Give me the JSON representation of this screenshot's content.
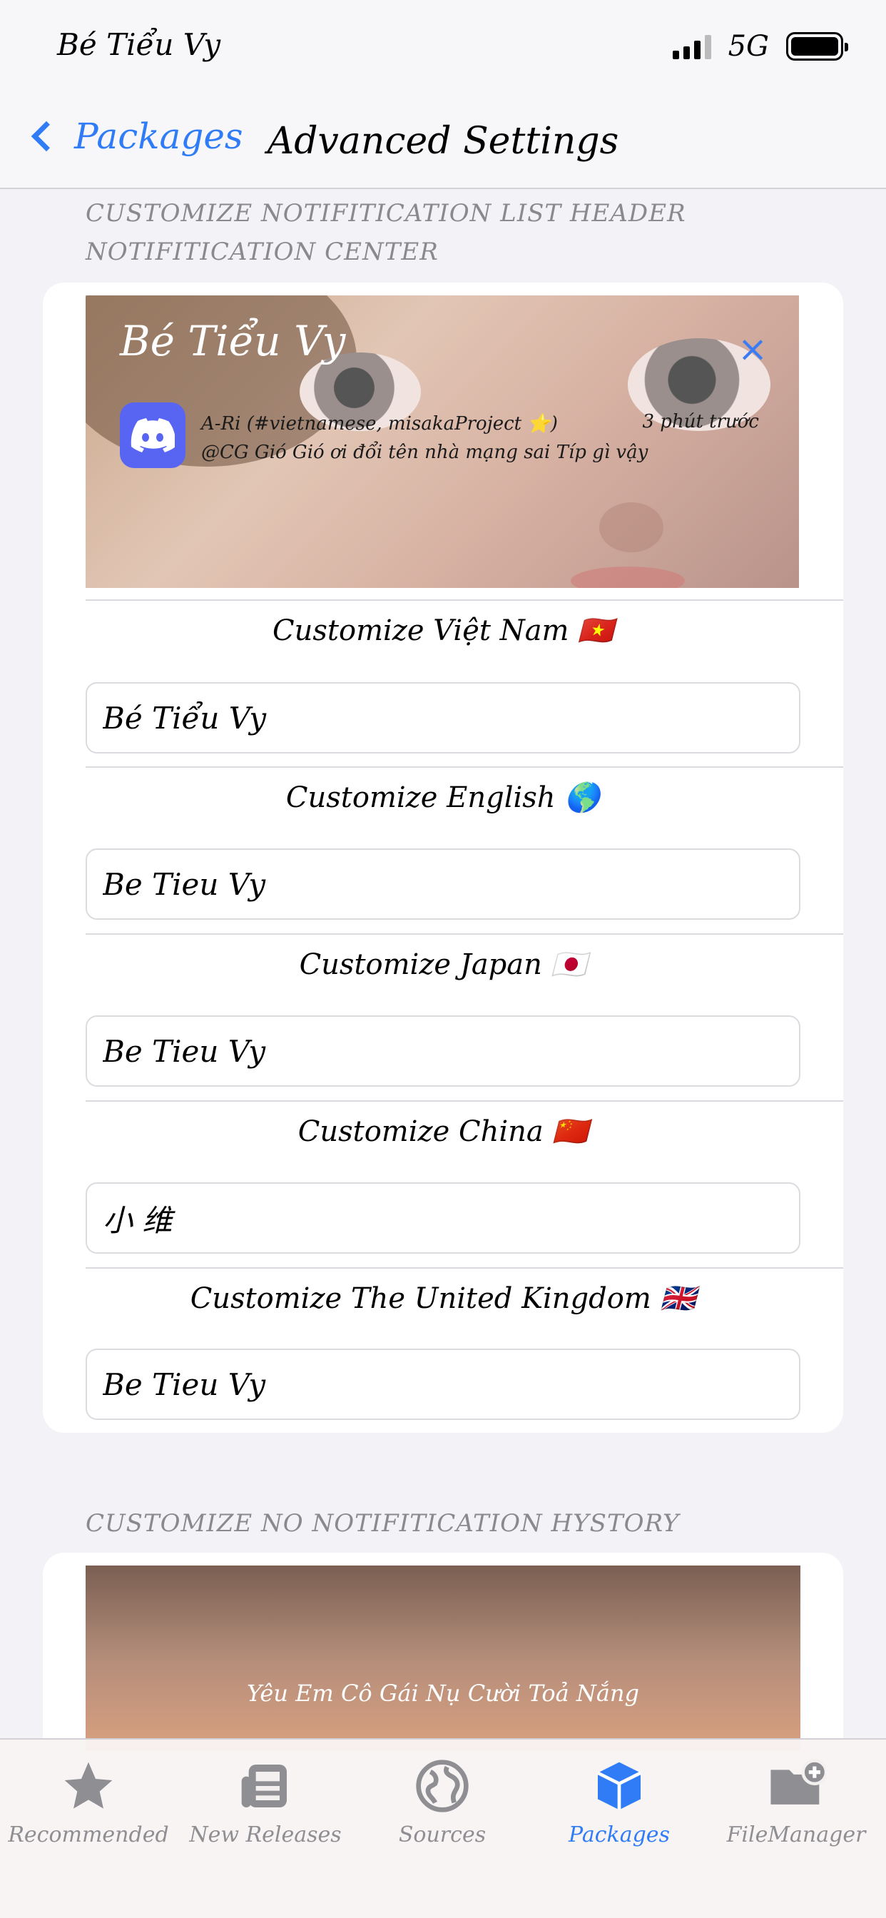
{
  "status": {
    "time": "Bé Tiểu Vy",
    "network": "5G"
  },
  "nav": {
    "back_label": "Packages",
    "title": "Advanced Settings"
  },
  "section1": {
    "header_line1": "CUSTOMIZE NOTIFITICATION LIST HEADER",
    "header_line2": "NOTIFITICATION CENTER",
    "preview": {
      "title": "Bé Tiểu Vy",
      "close": "×",
      "line1": "A-Ri (#vietnamese, misakaProject ⭐)",
      "line2": "@CG Gió Gió ơi đổi tên nhà mạng sai Típ gì vậy",
      "time": "3 phút trước"
    },
    "rows": [
      {
        "label": "Customize Việt Nam 🇻🇳",
        "value": "Bé Tiểu Vy"
      },
      {
        "label": "Customize English 🌎",
        "value": "Be Tieu Vy"
      },
      {
        "label": "Customize Japan 🇯🇵",
        "value": "Be Tieu Vy"
      },
      {
        "label": "Customize China 🇨🇳",
        "value": "小 维"
      },
      {
        "label": "Customize The United Kingdom 🇬🇧",
        "value": "Be Tieu Vy"
      }
    ]
  },
  "section2": {
    "header": "CUSTOMIZE NO NOTIFITICATION HYSTORY",
    "preview_text": "Yêu Em Cô Gái Nụ Cười Toả Nắng"
  },
  "tabs": [
    {
      "label": "Recommended",
      "icon": "star-icon"
    },
    {
      "label": "New Releases",
      "icon": "news-icon"
    },
    {
      "label": "Sources",
      "icon": "globe-icon"
    },
    {
      "label": "Packages",
      "icon": "box-icon",
      "active": true
    },
    {
      "label": "FileManager",
      "icon": "folder-add-icon"
    }
  ],
  "colors": {
    "accent": "#2f7cf6",
    "inactive": "#8e8e93",
    "discord": "#5865f2"
  }
}
